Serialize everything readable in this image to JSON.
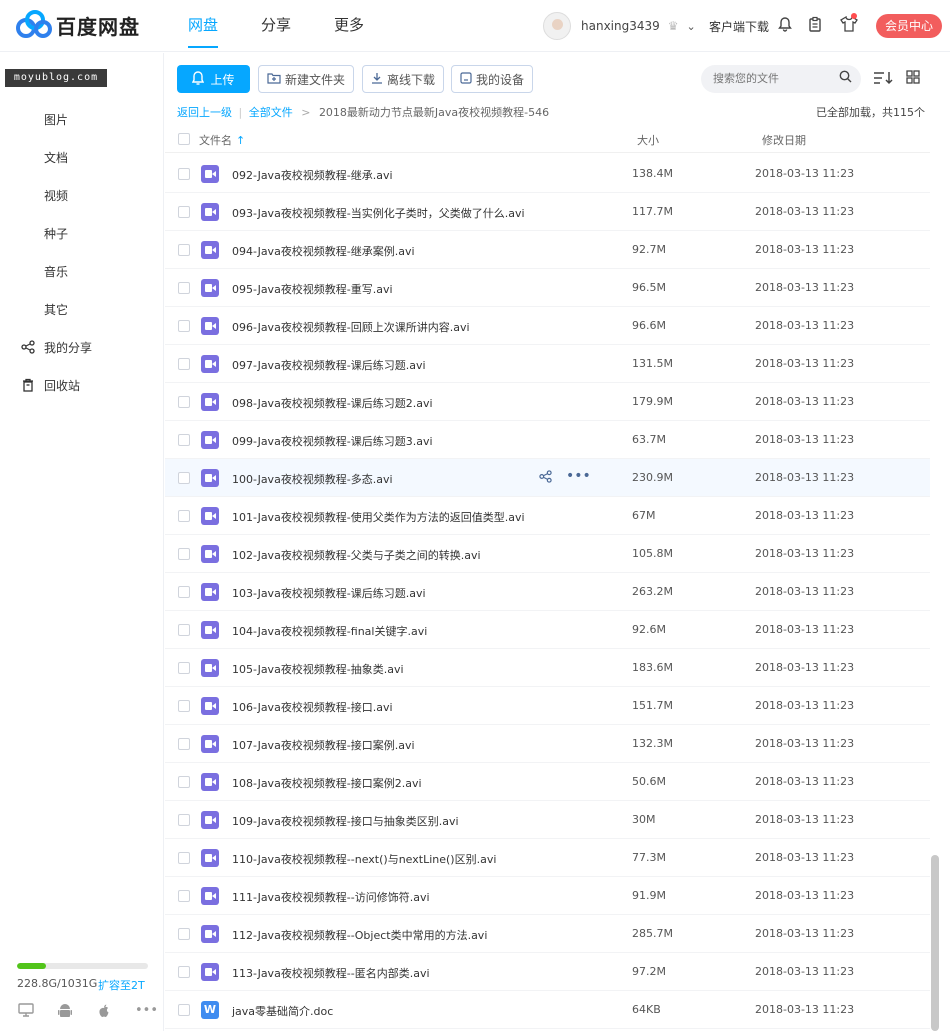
{
  "header": {
    "logo_text": "百度网盘",
    "nav": [
      {
        "label": "网盘",
        "active": true
      },
      {
        "label": "分享",
        "active": false
      },
      {
        "label": "更多",
        "active": false
      }
    ],
    "username": "hanxing3439",
    "client_download": "客户端下载",
    "vip_center": "会员中心"
  },
  "watermark": "moyublog.com",
  "sidebar": {
    "items": [
      {
        "label": "图片",
        "icon": ""
      },
      {
        "label": "文档",
        "icon": ""
      },
      {
        "label": "视频",
        "icon": ""
      },
      {
        "label": "种子",
        "icon": ""
      },
      {
        "label": "音乐",
        "icon": ""
      },
      {
        "label": "其它",
        "icon": ""
      },
      {
        "label": "我的分享",
        "icon": "share-icon"
      },
      {
        "label": "回收站",
        "icon": "trash-icon"
      }
    ],
    "storage": {
      "used_text": "228.8G/1031G",
      "fraction": 0.222,
      "expand_label": "扩容至2T"
    }
  },
  "toolbar": {
    "upload": "上传",
    "new_folder": "新建文件夹",
    "offline_download": "离线下载",
    "my_devices": "我的设备",
    "search_placeholder": "搜索您的文件"
  },
  "breadcrumb": {
    "back": "返回上一级",
    "all_files": "全部文件",
    "current": "2018最新动力节点最新Java夜校视频教程-546"
  },
  "loaded_info": "已全部加载，共115个",
  "columns": {
    "name": "文件名",
    "size": "大小",
    "date": "修改日期"
  },
  "files": [
    {
      "name": "092-Java夜校视频教程-继承.avi",
      "size": "138.4M",
      "date": "2018-03-13 11:23",
      "type": "video"
    },
    {
      "name": "093-Java夜校视频教程-当实例化子类时，父类做了什么.avi",
      "size": "117.7M",
      "date": "2018-03-13 11:23",
      "type": "video"
    },
    {
      "name": "094-Java夜校视频教程-继承案例.avi",
      "size": "92.7M",
      "date": "2018-03-13 11:23",
      "type": "video"
    },
    {
      "name": "095-Java夜校视频教程-重写.avi",
      "size": "96.5M",
      "date": "2018-03-13 11:23",
      "type": "video"
    },
    {
      "name": "096-Java夜校视频教程-回顾上次课所讲内容.avi",
      "size": "96.6M",
      "date": "2018-03-13 11:23",
      "type": "video"
    },
    {
      "name": "097-Java夜校视频教程-课后练习题.avi",
      "size": "131.5M",
      "date": "2018-03-13 11:23",
      "type": "video"
    },
    {
      "name": "098-Java夜校视频教程-课后练习题2.avi",
      "size": "179.9M",
      "date": "2018-03-13 11:23",
      "type": "video"
    },
    {
      "name": "099-Java夜校视频教程-课后练习题3.avi",
      "size": "63.7M",
      "date": "2018-03-13 11:23",
      "type": "video"
    },
    {
      "name": "100-Java夜校视频教程-多态.avi",
      "size": "230.9M",
      "date": "2018-03-13 11:23",
      "type": "video",
      "hover": true
    },
    {
      "name": "101-Java夜校视频教程-使用父类作为方法的返回值类型.avi",
      "size": "67M",
      "date": "2018-03-13 11:23",
      "type": "video"
    },
    {
      "name": "102-Java夜校视频教程-父类与子类之间的转换.avi",
      "size": "105.8M",
      "date": "2018-03-13 11:23",
      "type": "video"
    },
    {
      "name": "103-Java夜校视频教程-课后练习题.avi",
      "size": "263.2M",
      "date": "2018-03-13 11:23",
      "type": "video"
    },
    {
      "name": "104-Java夜校视频教程-final关键字.avi",
      "size": "92.6M",
      "date": "2018-03-13 11:23",
      "type": "video"
    },
    {
      "name": "105-Java夜校视频教程-抽象类.avi",
      "size": "183.6M",
      "date": "2018-03-13 11:23",
      "type": "video"
    },
    {
      "name": "106-Java夜校视频教程-接口.avi",
      "size": "151.7M",
      "date": "2018-03-13 11:23",
      "type": "video"
    },
    {
      "name": "107-Java夜校视频教程-接口案例.avi",
      "size": "132.3M",
      "date": "2018-03-13 11:23",
      "type": "video"
    },
    {
      "name": "108-Java夜校视频教程-接口案例2.avi",
      "size": "50.6M",
      "date": "2018-03-13 11:23",
      "type": "video"
    },
    {
      "name": "109-Java夜校视频教程-接口与抽象类区别.avi",
      "size": "30M",
      "date": "2018-03-13 11:23",
      "type": "video"
    },
    {
      "name": "110-Java夜校视频教程--next()与nextLine()区别.avi",
      "size": "77.3M",
      "date": "2018-03-13 11:23",
      "type": "video"
    },
    {
      "name": "111-Java夜校视频教程--访问修饰符.avi",
      "size": "91.9M",
      "date": "2018-03-13 11:23",
      "type": "video"
    },
    {
      "name": "112-Java夜校视频教程--Object类中常用的方法.avi",
      "size": "285.7M",
      "date": "2018-03-13 11:23",
      "type": "video"
    },
    {
      "name": "113-Java夜校视频教程--匿名内部类.avi",
      "size": "97.2M",
      "date": "2018-03-13 11:23",
      "type": "video"
    },
    {
      "name": "java零基础简介.doc",
      "size": "64KB",
      "date": "2018-03-13 11:23",
      "type": "doc"
    }
  ],
  "colors": {
    "accent": "#06a7ff",
    "video_icon": "#7a6fe0",
    "doc_icon": "#3f8cf0",
    "vip": "#f25d5d",
    "storage": "#52c41a"
  }
}
